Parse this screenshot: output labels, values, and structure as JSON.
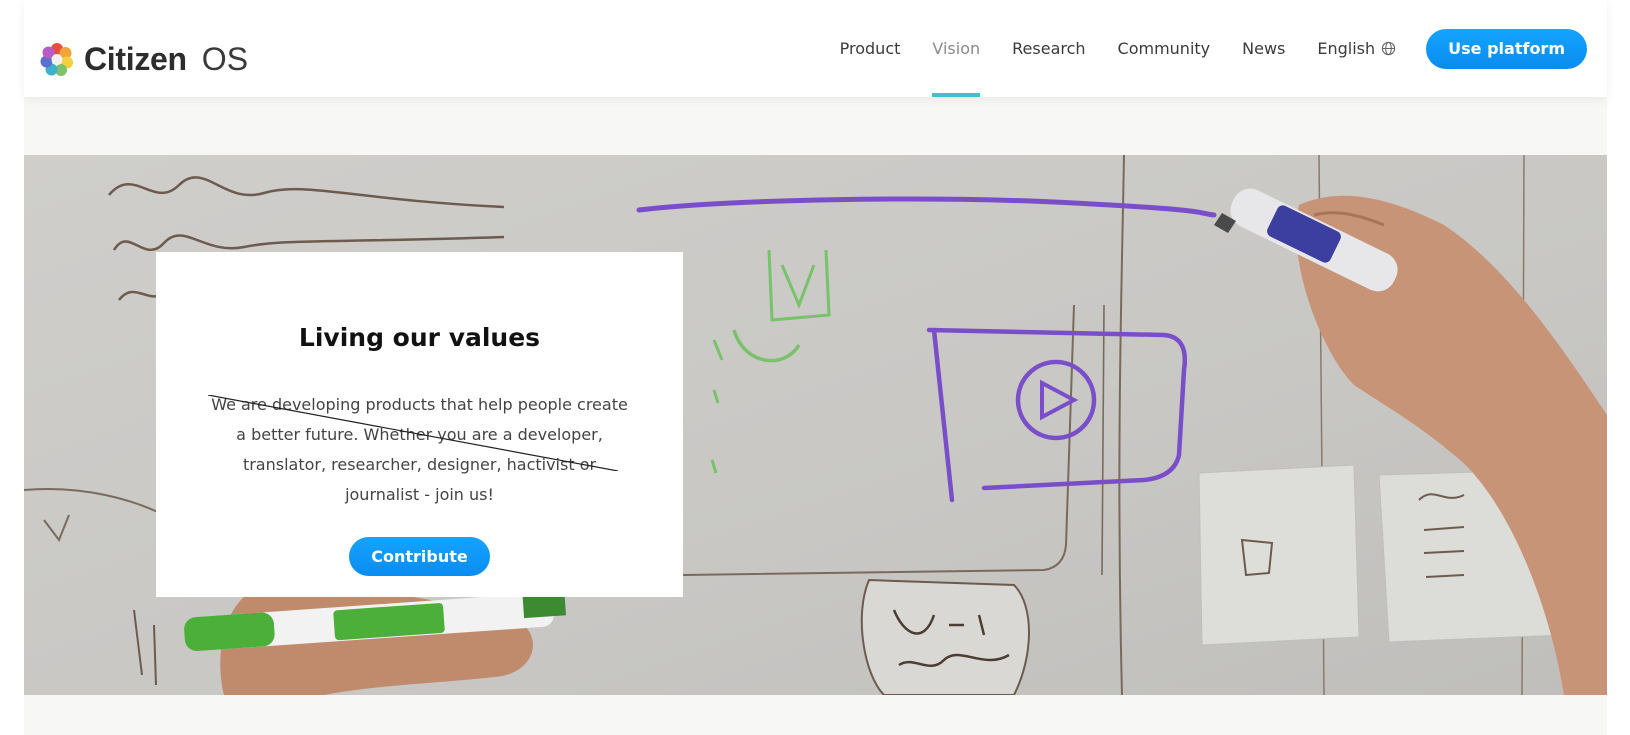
{
  "header": {
    "brand_bold": "Citizen",
    "brand_light": "OS",
    "logo_icon": "flower-logo-icon",
    "nav": [
      {
        "label": "Product",
        "active": false
      },
      {
        "label": "Vision",
        "active": true
      },
      {
        "label": "Research",
        "active": false
      },
      {
        "label": "Community",
        "active": false
      },
      {
        "label": "News",
        "active": false
      },
      {
        "label": "English",
        "icon": "globe-icon",
        "active": false
      }
    ],
    "cta_label": "Use platform"
  },
  "hero": {
    "image": "whiteboard-sketch-photo",
    "card": {
      "title": "Living our values",
      "body": "We are developing products that help people create a better future. Whether you are a developer, translator, researcher, designer, hactivist or journalist - join us!",
      "button_label": "Contribute"
    }
  },
  "colors": {
    "accent": "#0a8cf0",
    "active_underline": "#3fc2c9",
    "marker_purple": "#7b4ec9",
    "marker_green": "#4caf3a"
  }
}
